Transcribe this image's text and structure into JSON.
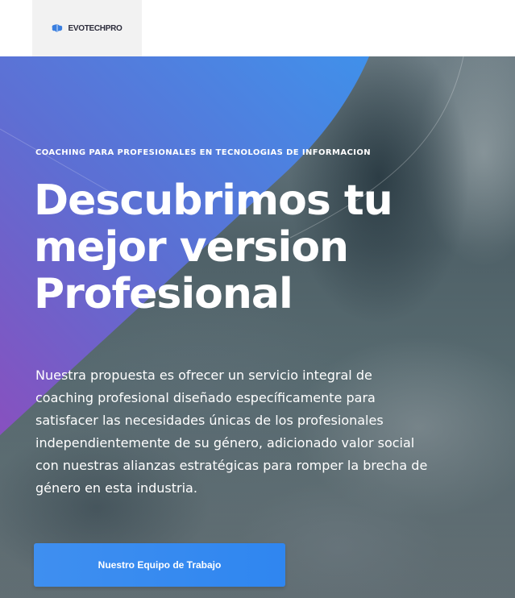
{
  "header": {
    "logo_text": "EVOTECHPRO",
    "logo_icon": "brain-icon"
  },
  "hero": {
    "eyebrow": "COACHING PARA PROFESIONALES EN TECNOLOGIAS DE INFORMACION",
    "headline_lines": [
      "Descubrimos tu",
      "mejor version",
      "Profesional"
    ],
    "description_lines": [
      "Nuestra propuesta es ofrecer un servicio integral de",
      "coaching profesional diseñado específicamente para",
      "satisfacer las necesidades únicas de los profesionales",
      "independientemente de su género, adicionado valor social",
      "con nuestras alianzas estratégicas para romper la brecha de",
      "género en esta industria."
    ],
    "cta_label": "Nuestro Equipo de Trabajo"
  },
  "colors": {
    "accent_blue": "#3f8ff0",
    "gradient_purple": "#8a4fc3",
    "gradient_blue": "#3d8ff0"
  }
}
